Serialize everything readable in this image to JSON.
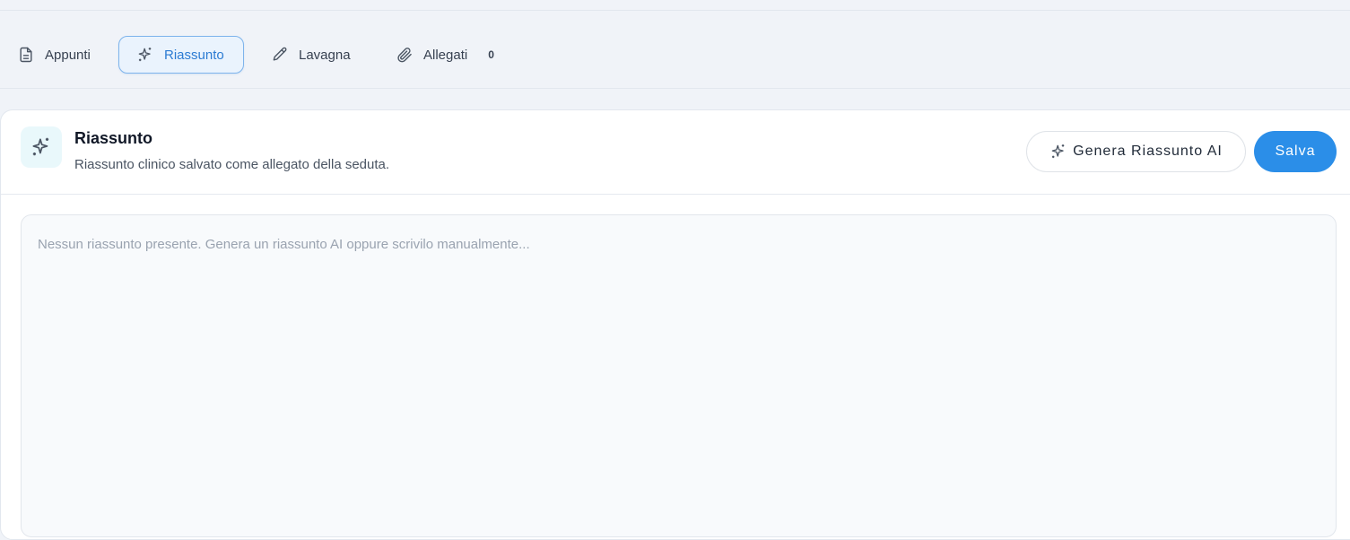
{
  "tabs": {
    "appunti": {
      "label": "Appunti",
      "icon": "document-icon"
    },
    "riassunto": {
      "label": "Riassunto",
      "icon": "sparkles-icon",
      "active": true
    },
    "lavagna": {
      "label": "Lavagna",
      "icon": "pencil-icon"
    },
    "allegati": {
      "label": "Allegati",
      "icon": "paperclip-icon",
      "count": "0"
    }
  },
  "panel": {
    "icon": "sparkles-icon",
    "title": "Riassunto",
    "subtitle": "Riassunto clinico salvato come allegato della seduta.",
    "generate_label": "Genera Riassunto AI",
    "save_label": "Salva"
  },
  "editor": {
    "value": "",
    "placeholder": "Nessun riassunto presente. Genera un riassunto AI oppure scrivilo manualmente..."
  },
  "colors": {
    "accent": "#2b8ee8",
    "active_tab_border": "#7eb4ec",
    "active_tab_bg": "#eaf3fd",
    "page_bg": "#f0f3f8"
  }
}
